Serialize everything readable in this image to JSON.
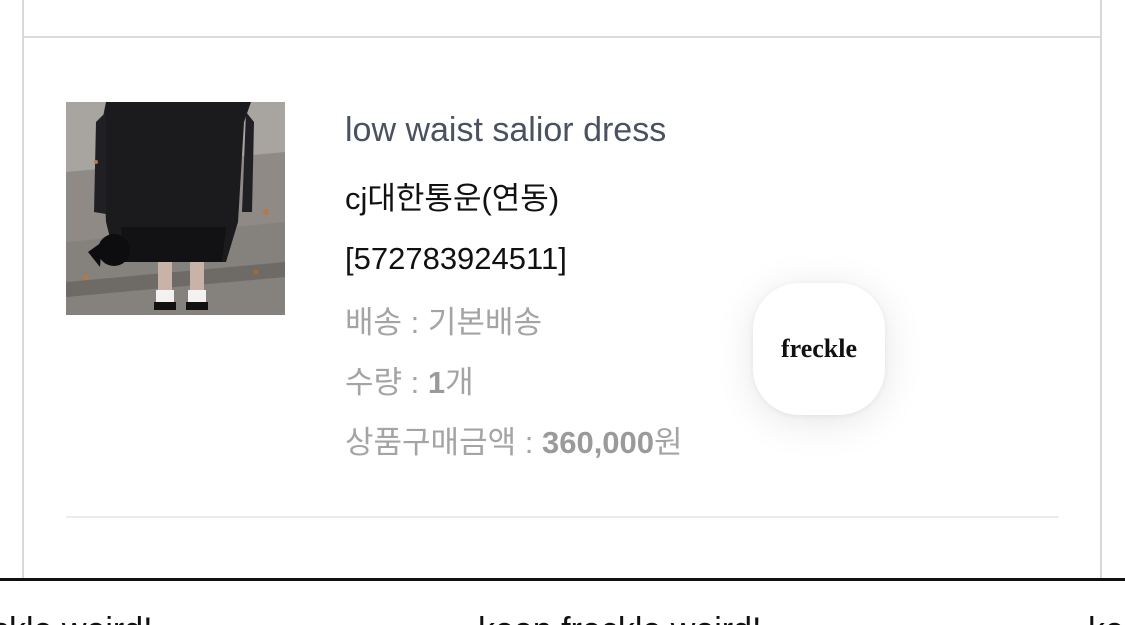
{
  "order_item": {
    "product_name": "low waist salior dress",
    "carrier": "cj대한통운(연동)",
    "tracking_number": "[572783924511]",
    "shipping_label": "배송 : ",
    "shipping_value": "기본배송",
    "quantity_label": "수량 : ",
    "quantity_value": "1",
    "quantity_unit": "개",
    "amount_label": "상품구매금액 : ",
    "amount_value": "360,000",
    "amount_unit": "원"
  },
  "floating_badge": {
    "label": "freckle"
  },
  "marquee": {
    "items": [
      "ckle weird!",
      "keep freckle weird!",
      "ke"
    ]
  }
}
